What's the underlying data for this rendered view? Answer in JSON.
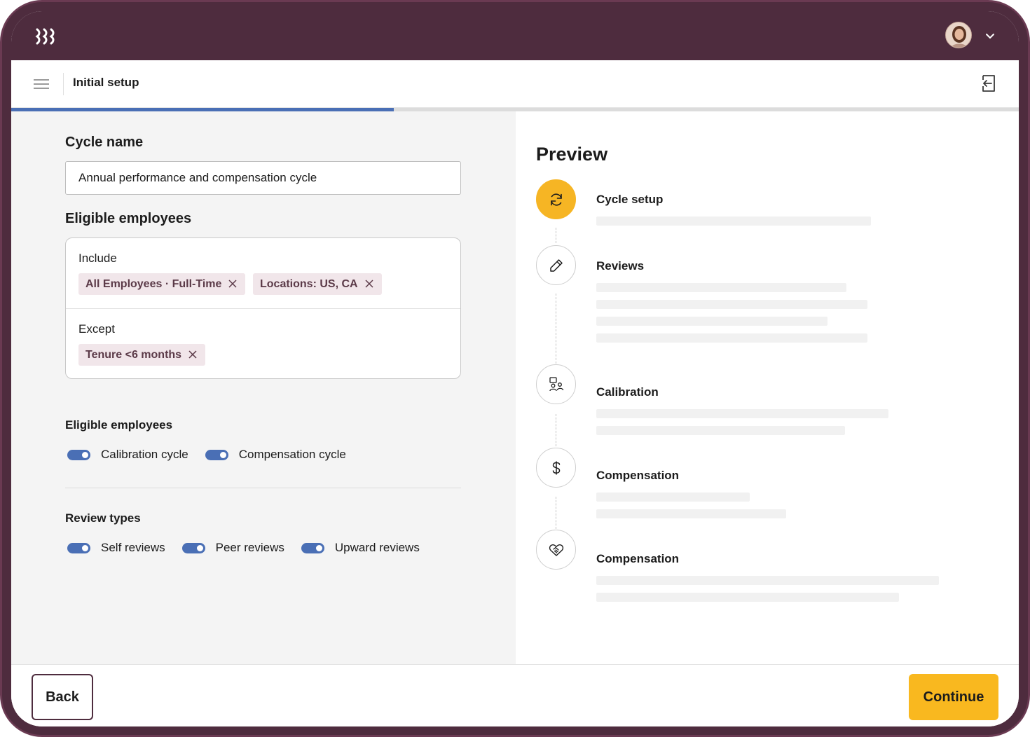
{
  "app": {
    "title": "Initial setup",
    "icons": {
      "logo": "rippling-logo",
      "menu": "menu-icon",
      "exit": "exit-icon",
      "avatar": "user-avatar",
      "caret": "chevron-down-icon"
    }
  },
  "progress": {
    "fraction": 0.38,
    "color": "#4a6fb5"
  },
  "form": {
    "cycle_name_label": "Cycle name",
    "cycle_name_value": "Annual performance and compensation cycle",
    "eligible_title": "Eligible employees",
    "include_label": "Include",
    "include_chips": [
      "All Employees · Full-Time",
      "Locations: US, CA"
    ],
    "except_label": "Except",
    "except_chips": [
      "Tenure <6 months"
    ],
    "eligible_toggles_title": "Eligible employees",
    "eligible_toggles": [
      {
        "label": "Calibration cycle",
        "on": true
      },
      {
        "label": "Compensation cycle",
        "on": true
      }
    ],
    "review_types_title": "Review types",
    "review_types": [
      {
        "label": "Self reviews",
        "on": true
      },
      {
        "label": "Peer reviews",
        "on": true
      },
      {
        "label": "Upward reviews",
        "on": true
      }
    ]
  },
  "preview": {
    "title": "Preview",
    "steps": [
      {
        "label": "Cycle setup",
        "icon": "refresh-icon"
      },
      {
        "label": "Reviews",
        "icon": "pencil-icon"
      },
      {
        "label": "Calibration",
        "icon": "people-icon"
      },
      {
        "label": "Compensation",
        "icon": "dollar-icon"
      },
      {
        "label": "Compensation",
        "icon": "handshake-heart-icon"
      }
    ]
  },
  "footer": {
    "back_label": "Back",
    "continue_label": "Continue"
  },
  "colors": {
    "brand": "#4e2c3e",
    "accent": "#f9b81f",
    "toggle": "#4a6fb5",
    "chip_bg": "#f1e6ea"
  }
}
